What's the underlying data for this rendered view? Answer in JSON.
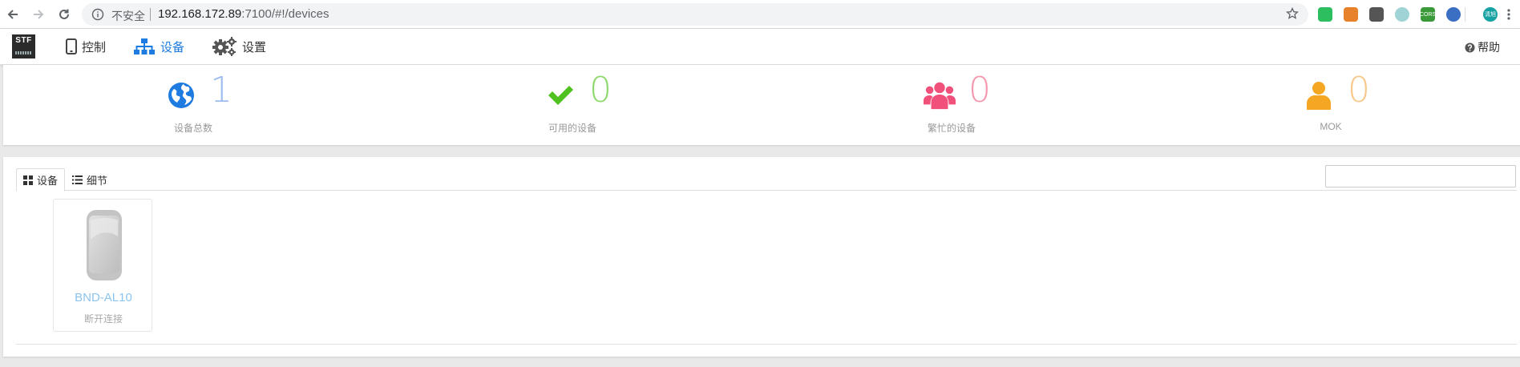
{
  "browser": {
    "security_label": "不安全",
    "url_host": "192.168.172.89",
    "url_rest": ":7100/#!/devices"
  },
  "extensions": [
    {
      "name": "evernote-extension",
      "color": "#2dbe60",
      "text": ""
    },
    {
      "name": "fox-extension",
      "color": "#e8822a",
      "text": ""
    },
    {
      "name": "compass-extension",
      "color": "#555555",
      "text": ""
    },
    {
      "name": "circle-extension",
      "color": "#9fd3d6",
      "text": ""
    },
    {
      "name": "cors-extension",
      "color": "#3a9a3a",
      "text": "CORS"
    },
    {
      "name": "globe-extension",
      "color": "#3a6fc4",
      "text": ""
    }
  ],
  "profile": {
    "text": "清旭"
  },
  "navbar": {
    "logo_text": "STF",
    "items": [
      {
        "label": "控制"
      },
      {
        "label": "设备"
      },
      {
        "label": "设置"
      }
    ],
    "help_label": "帮助"
  },
  "stats": [
    {
      "value": "1",
      "caption": "设备总数",
      "color": "#1e7be0",
      "icon": "globe-icon"
    },
    {
      "value": "0",
      "caption": "可用的设备",
      "color": "#4fc21f",
      "icon": "checkmark-icon"
    },
    {
      "value": "0",
      "caption": "繁忙的设备",
      "color": "#f0507a",
      "icon": "users-icon"
    },
    {
      "value": "0",
      "caption": "MOK",
      "color": "#f5a623",
      "icon": "user-icon"
    }
  ],
  "tabs": [
    {
      "label": "设备"
    },
    {
      "label": "细节"
    }
  ],
  "search": {
    "placeholder": ""
  },
  "devices": [
    {
      "name": "BND-AL10",
      "status": "断开连接"
    }
  ]
}
